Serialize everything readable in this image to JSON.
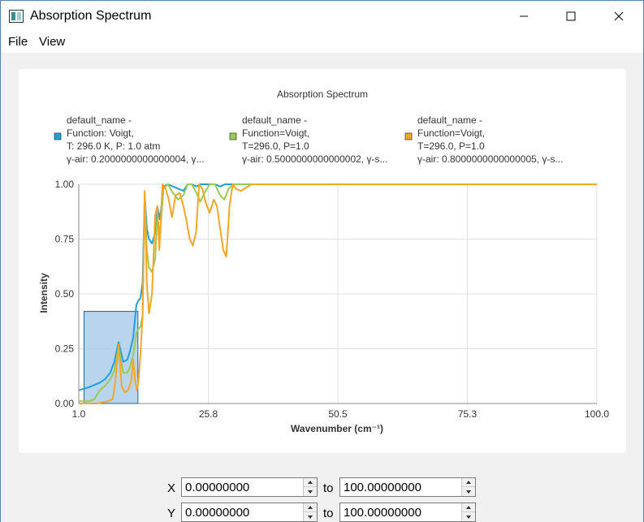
{
  "window": {
    "title": "Absorption Spectrum",
    "controls": {
      "minimize": "minimize-icon",
      "maximize": "maximize-icon",
      "close": "close-icon"
    }
  },
  "menu": {
    "file": "File",
    "view": "View"
  },
  "colors": {
    "series_blue": "#209fdf",
    "series_green": "#99ca53",
    "series_orange": "#f6a625",
    "zoom_fill": "#a8cbe9",
    "zoom_stroke": "#1f5f99"
  },
  "chart_data": {
    "type": "line",
    "title": "Absorption Spectrum",
    "xlabel": "Wavenumber (cm⁻¹)",
    "ylabel": "Intensity",
    "xlim": [
      1.0,
      100.0
    ],
    "ylim": [
      0.0,
      1.0
    ],
    "xticks": [
      "1.0",
      "25.8",
      "50.5",
      "75.3",
      "100.0"
    ],
    "yticks": [
      "0.00",
      "0.25",
      "0.50",
      "0.75",
      "1.00"
    ],
    "grid": true,
    "legend_position": "top",
    "selection": {
      "x": [
        2.0,
        12.3
      ],
      "y": [
        0.0,
        0.42
      ]
    },
    "series": [
      {
        "name": "default_name -\nFunction: Voigt,\nT: 296.0 K, P: 1.0 atm\nγ-air: 0.2000000000000004, γ...",
        "legend_lines": [
          "default_name -",
          "Function: Voigt,",
          "T: 296.0 K, P: 1.0 atm",
          "γ-air: 0.2000000000000004, γ..."
        ],
        "color": "#209fdf",
        "x": [
          1,
          3,
          5,
          6,
          7,
          7.8,
          8.6,
          9.5,
          10.3,
          10.8,
          11.4,
          12.0,
          12.4,
          12.8,
          13.2,
          13.6,
          14.0,
          14.4,
          15.0,
          15.6,
          16.0,
          16.5,
          17.2,
          18.0,
          19.0,
          20.0,
          21.0,
          21.8,
          22.6,
          23.5,
          24.2,
          25.0,
          26.0,
          27.0,
          28.0,
          29.0,
          30.0,
          31.0,
          32.0,
          34.0,
          40.0,
          60.0,
          80.0,
          100.0
        ],
        "y": [
          0.06,
          0.075,
          0.095,
          0.11,
          0.14,
          0.19,
          0.28,
          0.19,
          0.2,
          0.24,
          0.3,
          0.45,
          0.47,
          0.48,
          0.55,
          0.95,
          0.8,
          0.75,
          0.73,
          0.78,
          0.9,
          0.84,
          0.99,
          1.0,
          0.99,
          0.98,
          0.97,
          1.0,
          1.0,
          0.99,
          1.0,
          1.0,
          1.0,
          1.0,
          0.99,
          1.0,
          1.0,
          1.0,
          1.0,
          1.0,
          1.0,
          1.0,
          1.0,
          1.0
        ]
      },
      {
        "name": "default_name -\nFunction=Voigt,\nT=296.0, P=1.0\nγ-air: 0.5000000000000002, γ-s...",
        "legend_lines": [
          "default_name -",
          "Function=Voigt,",
          "T=296.0, P=1.0",
          "γ-air: 0.5000000000000002, γ-s..."
        ],
        "color": "#99ca53",
        "x": [
          1,
          2.2,
          3,
          4,
          5,
          6,
          7,
          7.8,
          8.6,
          9.5,
          10.3,
          10.8,
          11.4,
          12.0,
          12.4,
          12.8,
          13.2,
          13.6,
          14.0,
          14.4,
          15.0,
          15.6,
          16.0,
          16.5,
          17.2,
          18.0,
          19.0,
          20.0,
          21.0,
          21.8,
          22.6,
          23.5,
          24.2,
          25.0,
          26.0,
          27.0,
          28.0,
          28.8,
          29.6,
          30.5,
          31.5,
          33.0,
          40.0,
          60.0,
          80.0,
          100.0
        ],
        "y": [
          0.01,
          0.01,
          0.01,
          0.02,
          0.06,
          0.08,
          0.11,
          0.15,
          0.26,
          0.14,
          0.14,
          0.17,
          0.22,
          0.32,
          0.34,
          0.35,
          0.4,
          0.96,
          0.7,
          0.62,
          0.6,
          0.66,
          0.86,
          0.76,
          0.98,
          1.0,
          0.96,
          0.93,
          0.95,
          1.0,
          1.0,
          0.96,
          0.92,
          0.96,
          1.0,
          1.0,
          0.95,
          0.93,
          0.98,
          1.0,
          1.0,
          1.0,
          1.0,
          1.0,
          1.0,
          1.0
        ]
      },
      {
        "name": "default_name -\nFunction=Voigt,\nT=296.0, P=1.0\nγ-air: 0.8000000000000005, γ-s...",
        "legend_lines": [
          "default_name -",
          "Function=Voigt,",
          "T=296.0, P=1.0",
          "γ-air: 0.8000000000000005, γ-s..."
        ],
        "color": "#f6a625",
        "x": [
          1,
          2.5,
          3.5,
          4.5,
          5.5,
          6.5,
          7.5,
          8.0,
          8.6,
          9.2,
          9.8,
          10.4,
          11.0,
          11.4,
          11.8,
          12.1,
          12.4,
          12.8,
          13.2,
          13.6,
          14.0,
          14.4,
          15.0,
          15.6,
          16.0,
          16.4,
          17.0,
          17.6,
          18.2,
          18.8,
          19.5,
          20.3,
          21.0,
          21.6,
          22.2,
          22.8,
          23.4,
          24.0,
          24.6,
          25.2,
          26.0,
          26.8,
          27.4,
          28.0,
          28.6,
          29.2,
          29.8,
          30.4,
          31.0,
          32.0,
          34.0,
          40.0,
          60.0,
          80.0,
          100.0
        ],
        "y": [
          0.0,
          0.0,
          0.0,
          0.0,
          0.005,
          0.01,
          0.02,
          0.1,
          0.27,
          0.08,
          0.05,
          0.06,
          0.1,
          0.2,
          0.1,
          0.06,
          0.1,
          0.23,
          0.4,
          0.97,
          0.55,
          0.41,
          0.5,
          0.86,
          0.9,
          0.7,
          1.0,
          0.98,
          0.93,
          0.85,
          0.95,
          0.96,
          0.9,
          0.83,
          0.75,
          0.72,
          0.78,
          1.0,
          0.98,
          0.92,
          0.87,
          0.93,
          0.9,
          0.8,
          0.7,
          0.67,
          0.9,
          1.0,
          0.98,
          0.97,
          1.0,
          1.0,
          1.0,
          1.0,
          1.0
        ]
      }
    ]
  },
  "controls": {
    "x_label": "X",
    "y_label": "Y",
    "to_label": "to",
    "x_min": "0.00000000",
    "x_max": "100.00000000",
    "y_min": "0.00000000",
    "y_max": "100.00000000"
  }
}
